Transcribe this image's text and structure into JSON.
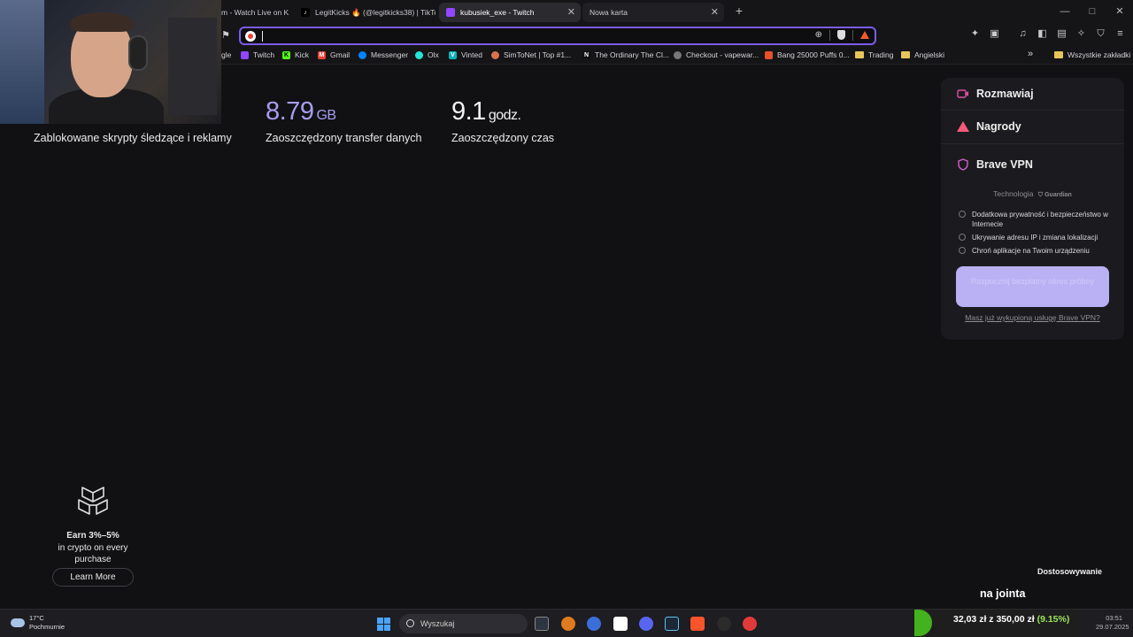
{
  "tabs": [
    {
      "title": "m - Watch Live on K",
      "icon": "kick-icon",
      "color": "#53fc18"
    },
    {
      "title": "LegitKicks 🔥 (@legitkicks38) | TikTok",
      "icon": "tiktok-icon",
      "color": "#000000"
    },
    {
      "title": "kubusiek_exe - Twitch",
      "icon": "twitch-icon",
      "color": "#9146ff"
    },
    {
      "title": "Nowa karta",
      "icon": "",
      "color": ""
    }
  ],
  "new_tab_symbol": "+",
  "window_controls": {
    "minimize": "—",
    "maximize": "□",
    "close": "✕"
  },
  "bookmarks": [
    {
      "label": "gle",
      "icon": "google-icon",
      "color": "#4285f4"
    },
    {
      "label": "Twitch",
      "icon": "twitch-icon",
      "color": "#9146ff"
    },
    {
      "label": "Kick",
      "icon": "kick-icon",
      "color": "#53fc18"
    },
    {
      "label": "Gmail",
      "icon": "gmail-icon",
      "color": "#ea4335"
    },
    {
      "label": "Messenger",
      "icon": "messenger-icon",
      "color": "#0084ff"
    },
    {
      "label": "Olx",
      "icon": "olx-icon",
      "color": "#23e5db"
    },
    {
      "label": "Vinted",
      "icon": "vinted-icon",
      "color": "#09b1ba"
    },
    {
      "label": "SimToNet | Top #1...",
      "icon": "simtonet-icon",
      "color": "#d9734e"
    },
    {
      "label": "The Ordinary The Cl...",
      "icon": "ordinary-icon",
      "color": "#111111"
    },
    {
      "label": "Checkout - vapewar...",
      "icon": "globe-icon",
      "color": "#888888"
    },
    {
      "label": "Bang 25000 Puffs 0...",
      "icon": "bang-icon",
      "color": "#e8502a"
    },
    {
      "label": "Trading",
      "icon": "folder-icon",
      "color": "#e8c55a"
    },
    {
      "label": "Angielski",
      "icon": "folder-icon",
      "color": "#e8c55a"
    }
  ],
  "bookmarks_overflow": "»",
  "all_bookmarks": "Wszystkie zakładki",
  "stats": [
    {
      "value": "",
      "unit": "",
      "label": "Zablokowane skrypty śledzące i reklamy"
    },
    {
      "value": "8.79",
      "unit": "GB",
      "label": "Zaoszczędzony transfer danych"
    },
    {
      "value": "9.1",
      "unit": "godz.",
      "label": "Zaoszczędzony czas"
    }
  ],
  "panel": {
    "chat": "Rozmawiaj",
    "rewards": "Nagrody",
    "vpn": "Brave VPN",
    "tech": "Technologia",
    "tech_brand": "Guardian",
    "features": [
      "Dodatkowa prywatność i bezpieczeństwo w Internecie",
      "Ukrywanie adresu IP i zmiana lokalizacji",
      "Chroń aplikacje na Twoim urządzeniu"
    ],
    "cta": "Rozpocznij bezpłatny okres próbny",
    "link": "Masz już wykupioną usługę Brave VPN?"
  },
  "crypto": {
    "line1": "Earn 3%–5%",
    "line2": "in crypto on every",
    "line3": "purchase",
    "button": "Learn More"
  },
  "customize": "Dostosowywanie",
  "overlay": "na jointa",
  "taskbar": {
    "temp": "17°C",
    "weather": "Pochmurnie",
    "search": "Wyszukaj",
    "profit_amount": "32,03 zł",
    "profit_z": "z",
    "profit_goal": "350,00 zł",
    "profit_pct": "(9.15%)",
    "time": "03:51",
    "date": "29.07.2025"
  }
}
